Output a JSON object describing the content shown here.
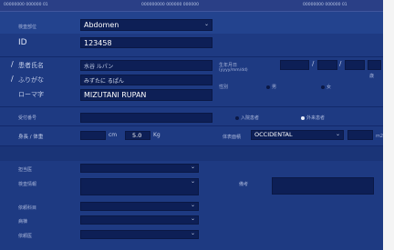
{
  "topbar": {
    "left": "00000000 000000 01",
    "center": "000000000 000000 000000",
    "right": "00000000 000000 01"
  },
  "exam": {
    "label": "検査部位",
    "value": "Abdomen"
  },
  "patient": {
    "id_label": "ID",
    "id_value": "123458",
    "name_label": "患者氏名",
    "name_value": "水谷 ルパン",
    "kana_label": "ふりがな",
    "kana_value": "みずたに るぱん",
    "roma_label": "ローマ字",
    "roma_value": "MIZUTANI RUPAN"
  },
  "birth": {
    "label": "生年月日",
    "sublabel": "(yyyy/mm/dd)",
    "sep1": "/",
    "sep2": "/",
    "age_unit": "歳"
  },
  "sex": {
    "label": "性別",
    "male": "男",
    "female": "女"
  },
  "reception": {
    "label": "受付番号",
    "opt1": "入院患者",
    "opt2": "外来患者"
  },
  "body": {
    "label": "身長 / 体重",
    "height_unit": "cm",
    "weight_value": "5.0",
    "weight_unit": "Kg"
  },
  "bsa": {
    "label": "体表面積",
    "value": "OCCIDENTAL",
    "unit": "m2"
  },
  "lower": {
    "doctor_label": "担当医",
    "info_label": "検査情報",
    "notes_label": "備考",
    "req1_label": "依頼科目",
    "req2_label": "病棟",
    "req3_label": "依頼医"
  }
}
